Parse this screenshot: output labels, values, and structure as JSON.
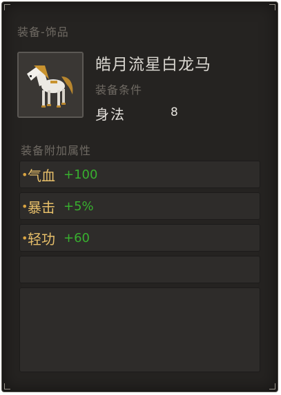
{
  "tooltip": {
    "category": "装备-饰品",
    "item_name": "皓月流星白龙马",
    "icon": "white-horse-icon",
    "requirement_label": "装备条件",
    "requirement": {
      "stat": "身法",
      "value": "8"
    },
    "attributes_label": "装备附加属性",
    "attributes": [
      {
        "bullet": "•",
        "name": "气血",
        "value": "+100"
      },
      {
        "bullet": "•",
        "name": "暴击",
        "value": "+5%"
      },
      {
        "bullet": "•",
        "name": "轻功",
        "value": "+60"
      }
    ]
  },
  "colors": {
    "panel_bg": "#252321",
    "muted_text": "#6f6a63",
    "attr_name": "#e7bf6a",
    "attr_value": "#38b02f"
  }
}
